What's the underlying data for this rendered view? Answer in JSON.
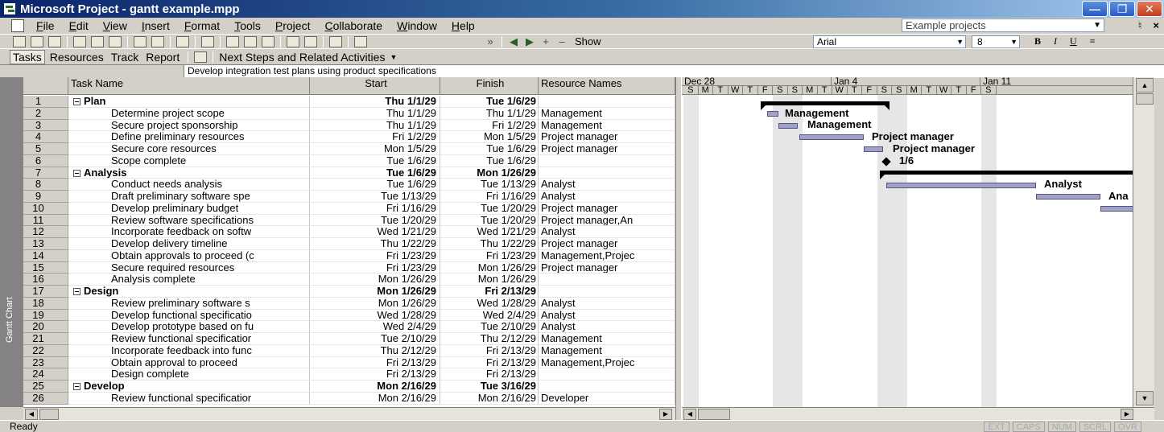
{
  "window": {
    "title": "Microsoft Project - gantt example.mpp"
  },
  "menu": {
    "items": [
      "File",
      "Edit",
      "View",
      "Insert",
      "Format",
      "Tools",
      "Project",
      "Collaborate",
      "Window",
      "Help"
    ],
    "help_box": "Example projects"
  },
  "toolbar": {
    "show_label": "Show",
    "font": "Arial",
    "size": "8",
    "bold": "B",
    "italic": "I",
    "underline": "U"
  },
  "guide": {
    "tasks": "Tasks",
    "resources": "Resources",
    "track": "Track",
    "report": "Report",
    "next_steps": "Next Steps and Related Activities"
  },
  "entry_bar": {
    "value": "Develop integration test plans using product specifications"
  },
  "view_bar": {
    "label": "Gantt Chart"
  },
  "table": {
    "headers": {
      "name": "Task Name",
      "start": "Start",
      "finish": "Finish",
      "resources": "Resource Names"
    },
    "rows": [
      {
        "id": "1",
        "name": "Plan",
        "start": "Thu 1/1/29",
        "finish": "Tue 1/6/29",
        "resources": "",
        "summary": true
      },
      {
        "id": "2",
        "name": "Determine project scope",
        "start": "Thu 1/1/29",
        "finish": "Thu 1/1/29",
        "resources": "Management"
      },
      {
        "id": "3",
        "name": "Secure project sponsorship",
        "start": "Thu 1/1/29",
        "finish": "Fri 1/2/29",
        "resources": "Management"
      },
      {
        "id": "4",
        "name": "Define preliminary resources",
        "start": "Fri 1/2/29",
        "finish": "Mon 1/5/29",
        "resources": "Project manager"
      },
      {
        "id": "5",
        "name": "Secure core resources",
        "start": "Mon 1/5/29",
        "finish": "Tue 1/6/29",
        "resources": "Project manager"
      },
      {
        "id": "6",
        "name": "Scope complete",
        "start": "Tue 1/6/29",
        "finish": "Tue 1/6/29",
        "resources": ""
      },
      {
        "id": "7",
        "name": "Analysis",
        "start": "Tue 1/6/29",
        "finish": "Mon 1/26/29",
        "resources": "",
        "summary": true
      },
      {
        "id": "8",
        "name": "Conduct needs analysis",
        "start": "Tue 1/6/29",
        "finish": "Tue 1/13/29",
        "resources": "Analyst"
      },
      {
        "id": "9",
        "name": "Draft preliminary software spe",
        "start": "Tue 1/13/29",
        "finish": "Fri 1/16/29",
        "resources": "Analyst"
      },
      {
        "id": "10",
        "name": "Develop preliminary budget",
        "start": "Fri 1/16/29",
        "finish": "Tue 1/20/29",
        "resources": "Project manager"
      },
      {
        "id": "11",
        "name": "Review software specifications",
        "start": "Tue 1/20/29",
        "finish": "Tue 1/20/29",
        "resources": "Project manager,An"
      },
      {
        "id": "12",
        "name": "Incorporate feedback on softw",
        "start": "Wed 1/21/29",
        "finish": "Wed 1/21/29",
        "resources": "Analyst"
      },
      {
        "id": "13",
        "name": "Develop delivery timeline",
        "start": "Thu 1/22/29",
        "finish": "Thu 1/22/29",
        "resources": "Project manager"
      },
      {
        "id": "14",
        "name": "Obtain approvals to proceed (c",
        "start": "Fri 1/23/29",
        "finish": "Fri 1/23/29",
        "resources": "Management,Projec"
      },
      {
        "id": "15",
        "name": "Secure required resources",
        "start": "Fri 1/23/29",
        "finish": "Mon 1/26/29",
        "resources": "Project manager"
      },
      {
        "id": "16",
        "name": "Analysis complete",
        "start": "Mon 1/26/29",
        "finish": "Mon 1/26/29",
        "resources": ""
      },
      {
        "id": "17",
        "name": "Design",
        "start": "Mon 1/26/29",
        "finish": "Fri 2/13/29",
        "resources": "",
        "summary": true
      },
      {
        "id": "18",
        "name": "Review preliminary software s",
        "start": "Mon 1/26/29",
        "finish": "Wed 1/28/29",
        "resources": "Analyst"
      },
      {
        "id": "19",
        "name": "Develop functional specificatio",
        "start": "Wed 1/28/29",
        "finish": "Wed 2/4/29",
        "resources": "Analyst"
      },
      {
        "id": "20",
        "name": "Develop prototype based on fu",
        "start": "Wed 2/4/29",
        "finish": "Tue 2/10/29",
        "resources": "Analyst"
      },
      {
        "id": "21",
        "name": "Review functional specificatior",
        "start": "Tue 2/10/29",
        "finish": "Thu 2/12/29",
        "resources": "Management"
      },
      {
        "id": "22",
        "name": "Incorporate feedback into func",
        "start": "Thu 2/12/29",
        "finish": "Fri 2/13/29",
        "resources": "Management"
      },
      {
        "id": "23",
        "name": "Obtain approval to proceed",
        "start": "Fri 2/13/29",
        "finish": "Fri 2/13/29",
        "resources": "Management,Projec"
      },
      {
        "id": "24",
        "name": "Design complete",
        "start": "Fri 2/13/29",
        "finish": "Fri 2/13/29",
        "resources": ""
      },
      {
        "id": "25",
        "name": "Develop",
        "start": "Mon 2/16/29",
        "finish": "Tue 3/16/29",
        "resources": "",
        "summary": true
      },
      {
        "id": "26",
        "name": "Review functional specificatior",
        "start": "Mon 2/16/29",
        "finish": "Mon 2/16/29",
        "resources": "Developer"
      }
    ]
  },
  "gantt": {
    "weeks": [
      "Dec 28",
      "Jan 4",
      "Jan 11"
    ],
    "days": [
      "S",
      "M",
      "T",
      "W",
      "T",
      "F",
      "S",
      "S",
      "M",
      "T",
      "W",
      "T",
      "F",
      "S",
      "S",
      "M",
      "T",
      "W",
      "T",
      "F",
      "S"
    ],
    "labels": {
      "r2": "Management",
      "r3": "Management",
      "r4": "Project manager",
      "r5": "Project manager",
      "r6": "1/6",
      "r8": "Analyst",
      "r9": "Ana"
    }
  },
  "status": {
    "text": "Ready",
    "indicators": [
      "EXT",
      "CAPS",
      "NUM",
      "SCRL",
      "OVR"
    ]
  }
}
